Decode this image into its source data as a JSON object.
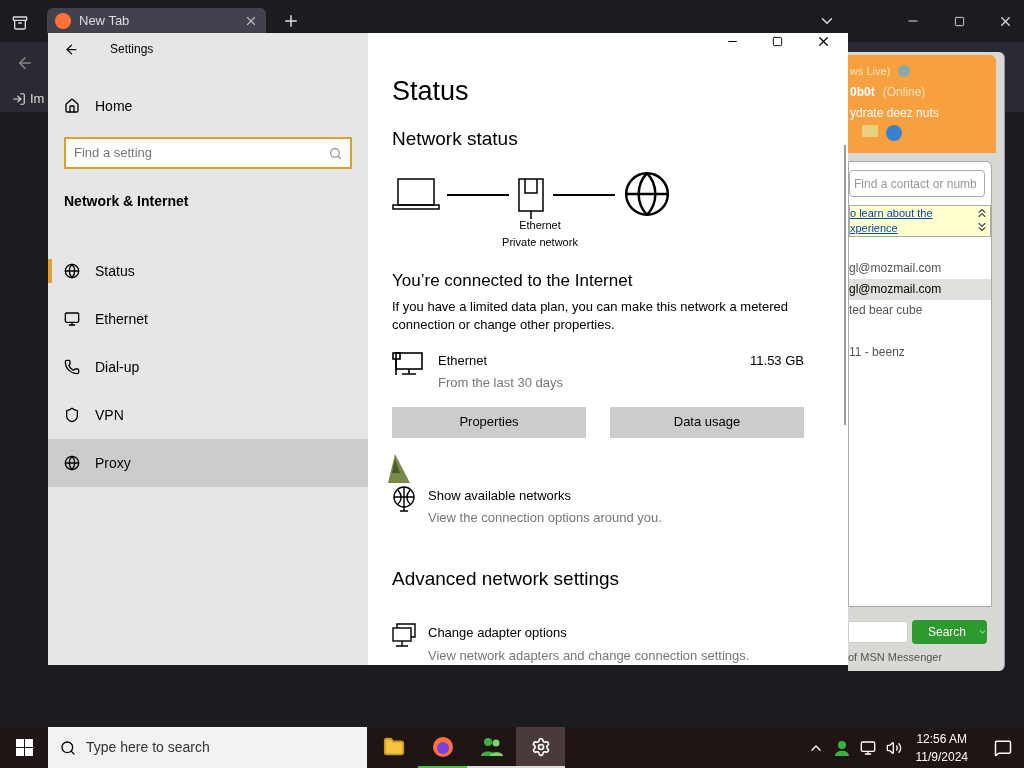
{
  "browser": {
    "tab": {
      "title": "New Tab",
      "selected": true
    },
    "toolbar_label": "Im"
  },
  "settings": {
    "title": "Settings",
    "home": "Home",
    "search": {
      "placeholder": "Find a setting"
    },
    "section": "Network & Internet",
    "nav": [
      {
        "label": "Status",
        "kind": "status",
        "selected": true,
        "hovered": false
      },
      {
        "label": "Ethernet",
        "kind": "ethernet",
        "selected": false,
        "hovered": false
      },
      {
        "label": "Dial-up",
        "kind": "dialup",
        "selected": false,
        "hovered": false
      },
      {
        "label": "VPN",
        "kind": "vpn",
        "selected": false,
        "hovered": false
      },
      {
        "label": "Proxy",
        "kind": "proxy",
        "selected": false,
        "hovered": true
      }
    ],
    "page_title": "Status",
    "network_status": "Network status",
    "diagram": {
      "adapter": "Ethernet",
      "network": "Private network"
    },
    "connected_heading": "You’re connected to the Internet",
    "connected_text": "If you have a limited data plan, you can make this network a metered connection or change other properties.",
    "connection": {
      "name": "Ethernet",
      "period": "From the last 30 days",
      "usage": "11.53 GB"
    },
    "buttons": [
      "Properties",
      "Data usage"
    ],
    "show_networks": {
      "title": "Show available networks",
      "subtitle": "View the connection options around you."
    },
    "advanced_heading": "Advanced network settings",
    "adapter_options": {
      "title": "Change adapter options",
      "subtitle": "View network adapters and change connection settings."
    }
  },
  "messenger": {
    "title": "ws Live)",
    "user": "0b0t",
    "status": "(Online)",
    "message": "ydrate deez nuts",
    "search": {
      "placeholder": "Find a contact or numb"
    },
    "banner": [
      "o learn about the",
      "xperience"
    ],
    "contacts": [
      {
        "label": "gl@mozmail.com",
        "selected": false
      },
      {
        "label": "gl@mozmail.com",
        "selected": true
      },
      {
        "label": "ted bear cube",
        "selected": false
      },
      {
        "label": "11 - beenz",
        "selected": false
      }
    ],
    "search_button": "Search",
    "footer": "of MSN Messenger"
  },
  "taskbar": {
    "search_placeholder": "Type here to search",
    "apps": [
      {
        "kind": "explorer",
        "running": false,
        "focused": false
      },
      {
        "kind": "firefox",
        "running": true,
        "focused": false
      },
      {
        "kind": "messenger",
        "running": true,
        "focused": false
      },
      {
        "kind": "settings",
        "running": true,
        "focused": true
      }
    ],
    "time": "12:56 AM",
    "date": "11/9/2024"
  }
}
